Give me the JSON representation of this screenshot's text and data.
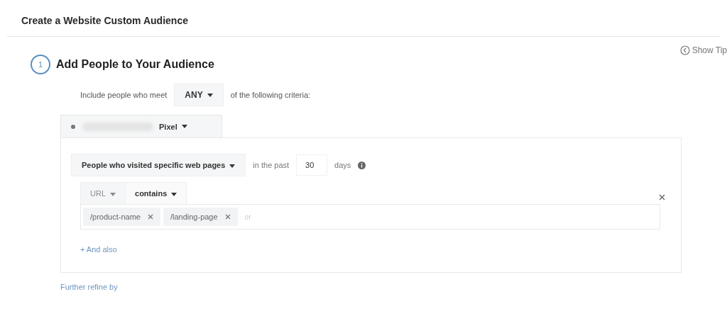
{
  "page_title": "Create a Website Custom Audience",
  "show_tips": "Show Tip",
  "step": {
    "number": "1",
    "title": "Add People to Your Audience"
  },
  "criteria": {
    "prefix": "Include people who meet",
    "match": "ANY",
    "suffix": "of the following criteria:"
  },
  "pixel_tab": {
    "label": "Pixel"
  },
  "rule": {
    "type": "People who visited specific web pages",
    "in_the_past": "in the past",
    "days_value": "30",
    "days_label": "days",
    "url_field": {
      "label": "URL",
      "disabled": true
    },
    "operator": "contains",
    "tags": [
      {
        "label": "/product-name"
      },
      {
        "label": "/landing-page"
      }
    ],
    "tags_placeholder": "or"
  },
  "and_also": "+ And also",
  "further_refine": "Further refine by"
}
